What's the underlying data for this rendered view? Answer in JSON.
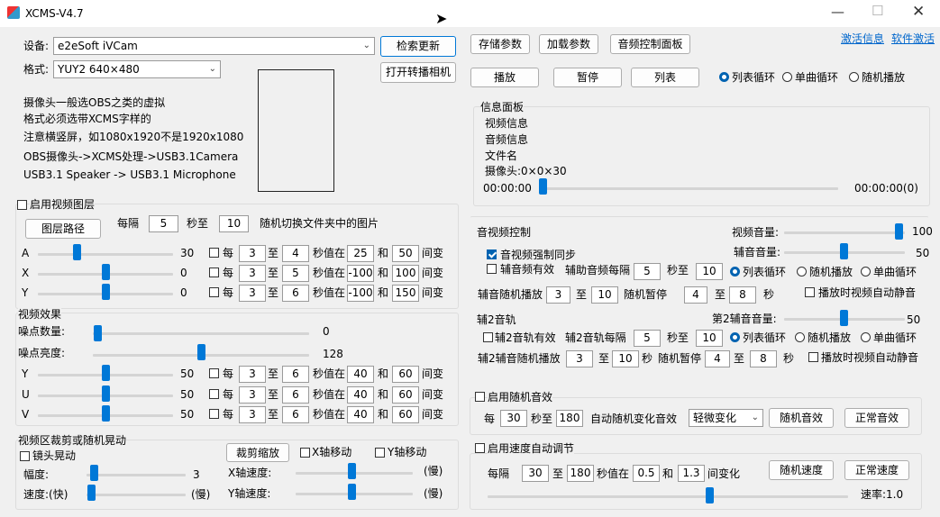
{
  "window": {
    "title": "XCMS-V4.7"
  },
  "device": {
    "device_label": "设备:",
    "device_value": "e2eSoft iVCam",
    "format_label": "格式:",
    "format_value": "YUY2 640×480",
    "search_btn": "检索更新",
    "open_camera_btn": "打开转播相机"
  },
  "notes": {
    "l1": "摄像头一般选OBS之类的虚拟",
    "l2": "格式必须选带XCMS字样的",
    "l3": "注意横竖屏，如1080x1920不是1920x1080",
    "l4": "OBS摄像头->XCMS处理->USB3.1Camera",
    "l5": "USB3.1 Speaker -> USB3.1 Microphone"
  },
  "layer": {
    "enable_label": "启用视频图层",
    "path_btn": "图层路径",
    "every": "每隔",
    "from": "5",
    "sec_to": "秒至",
    "to": "10",
    "suffix": "随机切换文件夹中的图片"
  },
  "axes_rows": [
    {
      "name": "A",
      "value": "30",
      "from": "3",
      "to": "4",
      "lo": "25",
      "hi": "50",
      "level": 0.28
    },
    {
      "name": "X",
      "value": "0",
      "from": "3",
      "to": "5",
      "lo": "-100",
      "hi": "100",
      "level": 0.5
    },
    {
      "name": "Y",
      "value": "0",
      "from": "3",
      "to": "6",
      "lo": "-100",
      "hi": "150",
      "level": 0.5
    }
  ],
  "common": {
    "every": "每",
    "to": "至",
    "sec_val": "秒值在",
    "and": "和",
    "change": "间变",
    "every_interval": "每隔"
  },
  "effects": {
    "title": "视频效果",
    "noise_count": "噪点数量:",
    "noise_count_value": "0",
    "noise_bright": "噪点亮度:",
    "noise_bright_value": "128",
    "yuv": [
      {
        "name": "Y",
        "value": "50",
        "from": "3",
        "to": "6",
        "lo": "40",
        "hi": "60"
      },
      {
        "name": "U",
        "value": "50",
        "from": "3",
        "to": "6",
        "lo": "40",
        "hi": "60"
      },
      {
        "name": "V",
        "value": "50",
        "from": "3",
        "to": "6",
        "lo": "40",
        "hi": "60"
      }
    ]
  },
  "crop": {
    "title": "视频区裁剪或随机晃动",
    "shake": "镜头晃动",
    "crop_btn": "裁剪缩放",
    "x_move": "X轴移动",
    "y_move": "Y轴移动",
    "amp": "幅度:",
    "amp_value": "3",
    "speed": "速度:(快)",
    "slow": "(慢)",
    "x_speed": "X轴速度:",
    "y_speed": "Y轴速度:"
  },
  "top": {
    "save": "存储参数",
    "load": "加载参数",
    "audio_panel": "音频控制面板",
    "activate": "激活信息",
    "soft_activate": "软件激活",
    "play": "播放",
    "pause": "暂停",
    "list": "列表",
    "loop_list": "列表循环",
    "loop_single": "单曲循环",
    "random_play": "随机播放"
  },
  "info": {
    "title": "信息面板",
    "video": "视频信息",
    "audio": "音频信息",
    "filename": "文件名",
    "camera": "摄像头:0×0×30",
    "time_start": "00:00:00",
    "time_end": "00:00:00(0)"
  },
  "av": {
    "title": "音视频控制",
    "video_vol": "视频音量:",
    "video_vol_value": "100",
    "aux_vol": "辅音音量:",
    "aux_vol_value": "50",
    "sync": "音视频强制同步",
    "aux_valid": "辅音频有效",
    "aux_every": "辅助音频每隔",
    "aux_from": "5",
    "sec_to": "秒至",
    "aux_to": "10",
    "aux_random": "辅音随机播放",
    "r_from": "3",
    "r_to": "10",
    "random_pause": "随机暂停",
    "p_from": "4",
    "p_to": "8",
    "sec": "秒",
    "mute": "播放时视频自动静音"
  },
  "track2": {
    "title": "辅2音轨",
    "vol": "第2辅音音量:",
    "vol_value": "50",
    "valid": "辅2音轨有效",
    "every": "辅2音轨每隔",
    "from": "5",
    "to": "10",
    "random": "辅2辅音随机播放",
    "r_from": "3",
    "r_to": "10",
    "p_from": "4",
    "p_to": "8"
  },
  "sfx": {
    "enable": "启用随机音效",
    "every": "每",
    "from": "30",
    "sec_to": "秒至",
    "to": "180",
    "suffix": "自动随机变化音效",
    "preset": "轻微变化",
    "random_btn": "随机音效",
    "normal_btn": "正常音效"
  },
  "speed": {
    "enable": "启用速度自动调节",
    "every": "每隔",
    "from": "30",
    "to": "180",
    "sec_val": "秒值在",
    "lo": "0.5",
    "and": "和",
    "hi": "1.3",
    "change": "间变化",
    "random_btn": "随机速度",
    "normal_btn": "正常速度",
    "rate": "速率:1.0"
  },
  "colors": {
    "accent": "#0078d7",
    "link": "#0066cc"
  }
}
